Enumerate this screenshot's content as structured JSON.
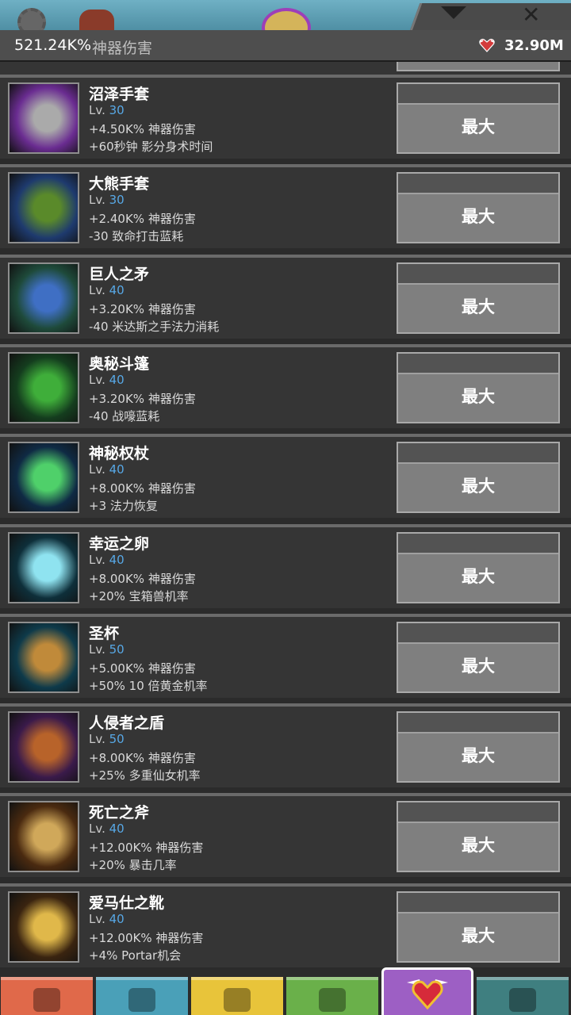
{
  "header": {
    "damage_value": "521.24K%",
    "damage_label": "神器伤害",
    "relic_total": "32.90M"
  },
  "artifacts": [
    {
      "name": "沼泽手套",
      "lv_label": "Lv.",
      "lv": "30",
      "effect1": "+4.50K% 神器伤害",
      "effect2": "+60秒钟 影分身术时间",
      "button": "最大",
      "icon": "swamp-gauntlet-icon",
      "colors": [
        "#6a2c91",
        "#aaa"
      ]
    },
    {
      "name": "大熊手套",
      "lv_label": "Lv.",
      "lv": "30",
      "effect1": "+2.40K% 神器伤害",
      "effect2": "-30 致命打击蓝耗",
      "button": "最大",
      "icon": "bear-glove-icon",
      "colors": [
        "#1e3a6e",
        "#5a8a2a"
      ]
    },
    {
      "name": "巨人之矛",
      "lv_label": "Lv.",
      "lv": "40",
      "effect1": "+3.20K% 神器伤害",
      "effect2": "-40 米达斯之手法力消耗",
      "button": "最大",
      "icon": "giant-spear-icon",
      "colors": [
        "#1e4a3a",
        "#3f6fc4"
      ]
    },
    {
      "name": "奥秘斗篷",
      "lv_label": "Lv.",
      "lv": "40",
      "effect1": "+3.20K% 神器伤害",
      "effect2": "-40 战嚎蓝耗",
      "button": "最大",
      "icon": "arcane-cloak-icon",
      "colors": [
        "#143d1e",
        "#3fae3a"
      ]
    },
    {
      "name": "神秘权杖",
      "lv_label": "Lv.",
      "lv": "40",
      "effect1": "+8.00K% 神器伤害",
      "effect2": "+3 法力恢复",
      "button": "最大",
      "icon": "mystic-staff-icon",
      "colors": [
        "#0f2a44",
        "#4fd06a"
      ]
    },
    {
      "name": "幸运之卵",
      "lv_label": "Lv.",
      "lv": "40",
      "effect1": "+8.00K% 神器伤害",
      "effect2": "+20% 宝箱兽机率",
      "button": "最大",
      "icon": "lucky-egg-icon",
      "colors": [
        "#0e2f3a",
        "#8fe3f0"
      ]
    },
    {
      "name": "圣杯",
      "lv_label": "Lv.",
      "lv": "50",
      "effect1": "+5.00K% 神器伤害",
      "effect2": "+50% 10 倍黄金机率",
      "button": "最大",
      "icon": "holy-grail-icon",
      "colors": [
        "#0e3a4a",
        "#c08a3a"
      ]
    },
    {
      "name": "人侵者之盾",
      "lv_label": "Lv.",
      "lv": "50",
      "effect1": "+8.00K% 神器伤害",
      "effect2": "+25% 多重仙女机率",
      "button": "最大",
      "icon": "invader-shield-icon",
      "colors": [
        "#3a1a4a",
        "#b8632a"
      ]
    },
    {
      "name": "死亡之斧",
      "lv_label": "Lv.",
      "lv": "40",
      "effect1": "+12.00K% 神器伤害",
      "effect2": "+20% 暴击几率",
      "button": "最大",
      "icon": "death-axe-icon",
      "colors": [
        "#4a2a10",
        "#d0a85a"
      ]
    },
    {
      "name": "爱马仕之靴",
      "lv_label": "Lv.",
      "lv": "40",
      "effect1": "+12.00K% 神器伤害",
      "effect2": "+4% Portar机会",
      "button": "最大",
      "icon": "hermes-boots-icon",
      "colors": [
        "#3a2410",
        "#e0b84a"
      ]
    }
  ],
  "nav_tabs": [
    {
      "name": "nav-tab-sword",
      "icon": "sword-icon",
      "color": "#e0694a"
    },
    {
      "name": "nav-tab-heroes",
      "icon": "viking-helmet-icon",
      "color": "#4aa0b8"
    },
    {
      "name": "nav-tab-equipment",
      "icon": "shirt-icon",
      "color": "#e8c43a"
    },
    {
      "name": "nav-tab-pets",
      "icon": "pet-icon",
      "color": "#6ab04a"
    },
    {
      "name": "nav-tab-artifacts",
      "icon": "winged-heart-icon",
      "color": "#9d5fc4",
      "active": true
    },
    {
      "name": "nav-tab-shop",
      "icon": "chest-icon",
      "color": "#3f7f80"
    }
  ]
}
